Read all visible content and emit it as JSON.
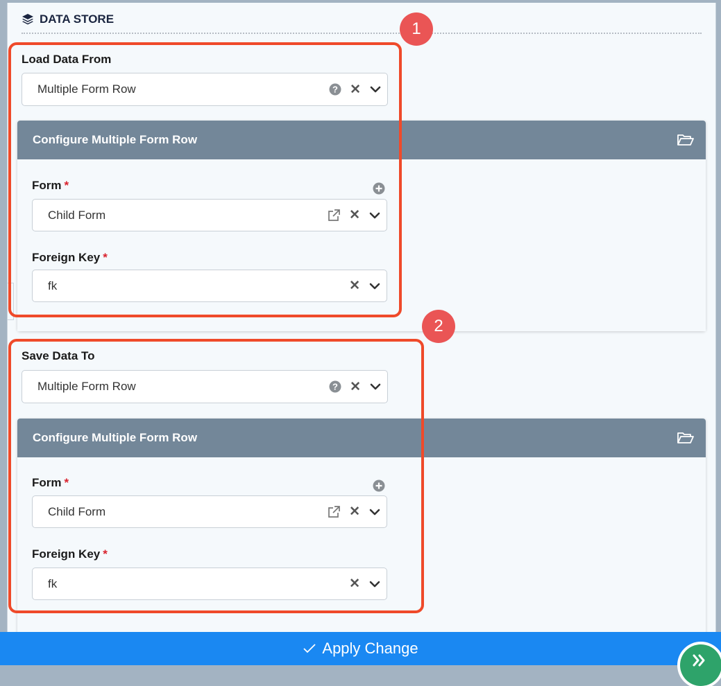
{
  "section": {
    "title": "DATA STORE",
    "icon": "layers-icon"
  },
  "load": {
    "label": "Load Data From",
    "value": "Multiple Form Row",
    "config_title": "Configure Multiple Form Row",
    "form_label": "Form",
    "form_value": "Child Form",
    "fk_label": "Foreign Key",
    "fk_value": "fk"
  },
  "save": {
    "label": "Save Data To",
    "value": "Multiple Form Row",
    "config_title": "Configure Multiple Form Row",
    "form_label": "Form",
    "form_value": "Child Form",
    "fk_label": "Foreign Key",
    "fk_value": "fk"
  },
  "required_marker": "*",
  "badges": {
    "one": "1",
    "two": "2"
  },
  "apply": {
    "label": "Apply Change"
  },
  "colors": {
    "header_bar": "#738799",
    "callout": "#ef4a2a",
    "badge": "#ea5555",
    "apply_bar": "#1a88f2",
    "fab": "#2ea36a"
  }
}
